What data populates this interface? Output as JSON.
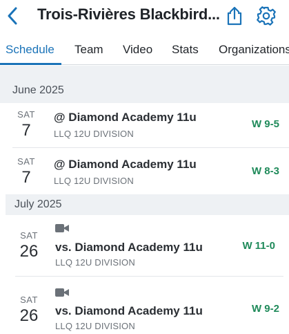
{
  "header": {
    "title": "Trois-Rivières Blackbird...",
    "back_icon": "chevron-left-icon",
    "share_icon": "share-icon",
    "settings_icon": "gear-icon"
  },
  "tabs": [
    {
      "label": "Schedule",
      "active": true
    },
    {
      "label": "Team",
      "active": false
    },
    {
      "label": "Video",
      "active": false
    },
    {
      "label": "Stats",
      "active": false
    },
    {
      "label": "Organizations",
      "active": false
    }
  ],
  "colors": {
    "accent": "#1a73b8",
    "win": "#1f8a5a",
    "section_bg": "#eef1f4"
  },
  "sections": [
    {
      "label": "June 2025",
      "games": [
        {
          "day_name": "SAT",
          "day_num": "7",
          "opponent": "@ Diamond Academy 11u",
          "division": "LLQ 12U DIVISION",
          "result": "W 9-5",
          "has_video": false
        },
        {
          "day_name": "SAT",
          "day_num": "7",
          "opponent": "@ Diamond Academy 11u",
          "division": "LLQ 12U DIVISION",
          "result": "W 8-3",
          "has_video": false
        }
      ]
    },
    {
      "label": "July 2025",
      "games": [
        {
          "day_name": "SAT",
          "day_num": "26",
          "opponent": "vs. Diamond Academy 11u",
          "division": "LLQ 12U DIVISION",
          "result": "W 11-0",
          "has_video": true,
          "video_icon": "video-camera-icon"
        },
        {
          "day_name": "SAT",
          "day_num": "26",
          "opponent": "vs. Diamond Academy 11u",
          "division": "LLQ 12U DIVISION",
          "result": "W 9-2",
          "has_video": true,
          "video_icon": "video-camera-icon"
        }
      ]
    }
  ]
}
